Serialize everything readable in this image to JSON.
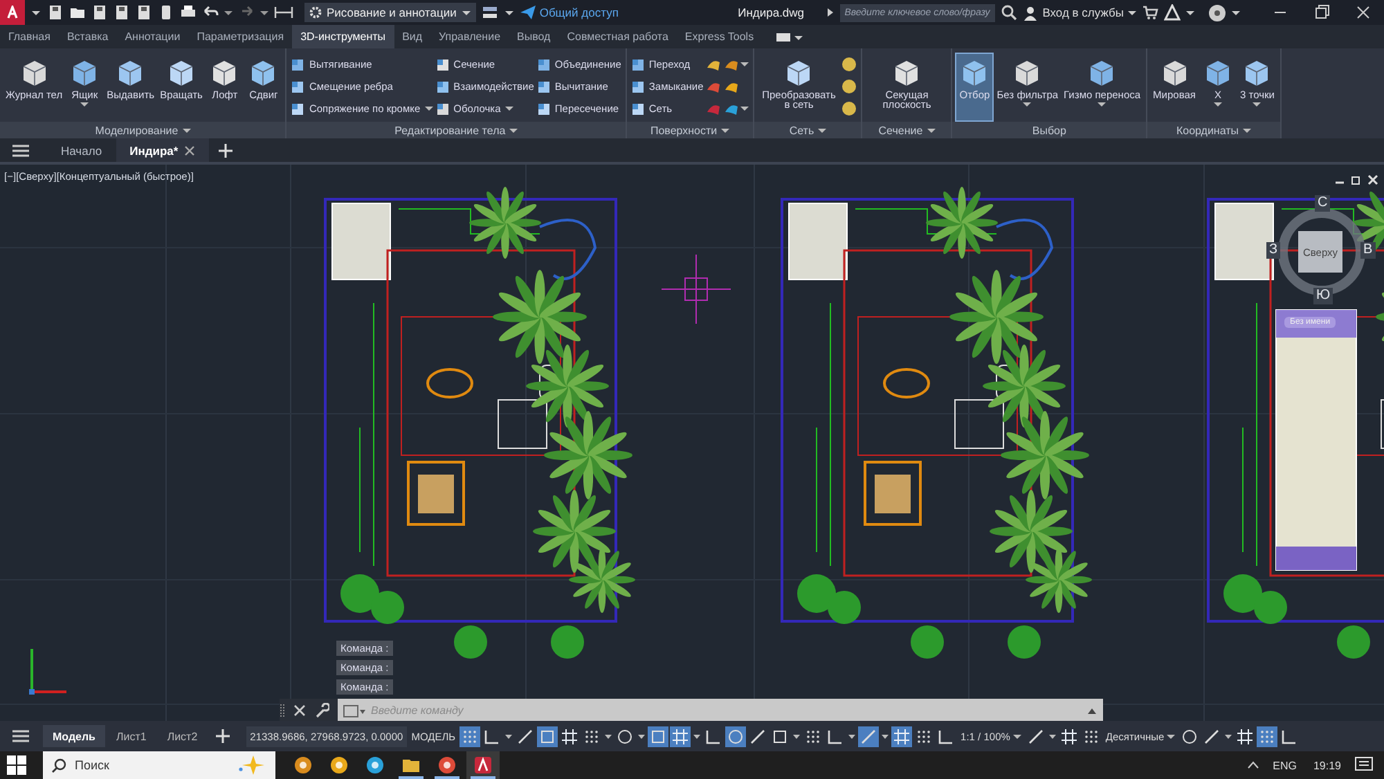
{
  "title_bar": {
    "workspace": "Рисование и аннотации",
    "share": "Общий доступ",
    "title": "Индира.dwg",
    "search": {
      "placeholder": "Введите ключевое слово/фразу"
    },
    "sign_in": "Вход в службы"
  },
  "ribbon": {
    "tabs": [
      {
        "label": "Главная",
        "selected": false
      },
      {
        "label": "Вставка",
        "selected": false
      },
      {
        "label": "Аннотации",
        "selected": false
      },
      {
        "label": "Параметризация",
        "selected": false
      },
      {
        "label": "3D-инструменты",
        "selected": true
      },
      {
        "label": "Вид",
        "selected": false
      },
      {
        "label": "Управление",
        "selected": false
      },
      {
        "label": "Вывод",
        "selected": false
      },
      {
        "label": "Совместная работа",
        "selected": false
      },
      {
        "label": "Express Tools",
        "selected": false
      }
    ],
    "panels": [
      {
        "title": "Моделирование",
        "menu": true,
        "items": [
          {
            "kind": "large",
            "label": "Журнал тел"
          },
          {
            "kind": "large",
            "label": "Ящик",
            "dropdown": true
          },
          {
            "kind": "large",
            "label": "Выдавить"
          },
          {
            "kind": "large",
            "label": "Вращать"
          },
          {
            "kind": "large",
            "label": "Лофт"
          },
          {
            "kind": "large",
            "label": "Сдвиг"
          }
        ]
      },
      {
        "title": "Редактирование тела",
        "menu": true,
        "items": [
          {
            "kind": "small",
            "label": "Вытягивание"
          },
          {
            "kind": "small",
            "label": "Смещение ребра"
          },
          {
            "kind": "small",
            "label": "Сопряжение по кромке",
            "dropdown": true
          },
          {
            "kind": "small",
            "label": "Сечение"
          },
          {
            "kind": "small",
            "label": "Взаимодействие"
          },
          {
            "kind": "small",
            "label": "Оболочка",
            "dropdown": true
          },
          {
            "kind": "small",
            "label": "Объединение"
          },
          {
            "kind": "small",
            "label": "Вычитание"
          },
          {
            "kind": "small",
            "label": "Пересечение"
          }
        ]
      },
      {
        "title": "Поверхности",
        "menu": true,
        "items": [
          {
            "kind": "small",
            "label": "Переход"
          },
          {
            "kind": "small",
            "label": "Замыкание"
          },
          {
            "kind": "small",
            "label": "Сеть"
          },
          {
            "kind": "icon"
          },
          {
            "kind": "icon"
          },
          {
            "kind": "icon"
          },
          {
            "kind": "icon",
            "dropdown": true
          },
          {
            "kind": "icon"
          },
          {
            "kind": "icon",
            "dropdown": true
          }
        ]
      },
      {
        "title": "Сеть",
        "menu": true,
        "items": [
          {
            "kind": "large",
            "label": "Преобразовать в сеть"
          },
          {
            "kind": "icon"
          },
          {
            "kind": "icon"
          },
          {
            "kind": "icon"
          }
        ]
      },
      {
        "title": "Сечение",
        "menu": true,
        "items": [
          {
            "kind": "large",
            "label": "Секущая плоскость"
          }
        ]
      },
      {
        "title": "Выбор",
        "menu": false,
        "items": [
          {
            "kind": "large",
            "label": "Отбор",
            "selected": true
          },
          {
            "kind": "large",
            "label": "Без фильтра",
            "dropdown": true,
            "selected": false
          },
          {
            "kind": "large",
            "label": "Гизмо переноса",
            "dropdown": true,
            "selected": false
          }
        ]
      },
      {
        "title": "Координаты",
        "menu": true,
        "items": [
          {
            "kind": "large",
            "label": "Мировая"
          },
          {
            "kind": "large",
            "label": "X",
            "dropdown": true
          },
          {
            "kind": "large",
            "label": "3 точки",
            "dropdown": true
          }
        ]
      }
    ]
  },
  "file_tabs": [
    {
      "label": "Начало",
      "selected": false,
      "closable": false
    },
    {
      "label": "Индира*",
      "selected": true,
      "closable": true
    }
  ],
  "viewport": {
    "controls": [
      "[−]",
      "[Сверху]",
      "[Концептуальный (быстрое)]"
    ],
    "viewcube": {
      "top": "Сверху",
      "north": "С",
      "west": "З",
      "east": "В",
      "south": "Ю",
      "ucs": "Без имени"
    },
    "history": [
      "Команда :",
      "Команда :",
      "Команда :"
    ],
    "command": {
      "placeholder": "Введите команду"
    }
  },
  "status_bar": {
    "layouts": [
      {
        "label": "Модель",
        "selected": true
      },
      {
        "label": "Лист1",
        "selected": false
      },
      {
        "label": "Лист2",
        "selected": false
      }
    ],
    "coordinates": "21338.9686, 27968.9723, 0.0000",
    "tools": [
      {
        "kind": "button",
        "label": "МОДЕЛЬ"
      },
      {
        "kind": "toggle",
        "on": true
      },
      {
        "kind": "toggle",
        "on": false
      },
      {
        "kind": "caret"
      },
      {
        "kind": "toggle",
        "on": false
      },
      {
        "kind": "toggle",
        "on": true
      },
      {
        "kind": "toggle",
        "on": false
      },
      {
        "kind": "toggle",
        "on": false
      },
      {
        "kind": "caret"
      },
      {
        "kind": "toggle",
        "on": false
      },
      {
        "kind": "caret"
      },
      {
        "kind": "toggle",
        "on": true
      },
      {
        "kind": "toggle",
        "on": true
      },
      {
        "kind": "caret"
      },
      {
        "kind": "toggle",
        "on": false
      },
      {
        "kind": "toggle",
        "on": true
      },
      {
        "kind": "toggle",
        "on": false
      },
      {
        "kind": "toggle",
        "on": false
      },
      {
        "kind": "caret"
      },
      {
        "kind": "toggle",
        "on": false
      },
      {
        "kind": "toggle",
        "on": false
      },
      {
        "kind": "caret"
      },
      {
        "kind": "toggle",
        "on": true
      },
      {
        "kind": "caret"
      },
      {
        "kind": "toggle",
        "on": true
      },
      {
        "kind": "toggle",
        "on": false
      },
      {
        "kind": "toggle",
        "on": false
      },
      {
        "kind": "button",
        "label": "1:1 / 100%",
        "menu": true
      },
      {
        "kind": "toggle",
        "on": false
      },
      {
        "kind": "caret"
      },
      {
        "kind": "toggle",
        "on": false
      },
      {
        "kind": "toggle",
        "on": false
      },
      {
        "kind": "button",
        "label": "Десятичные",
        "menu": true
      },
      {
        "kind": "toggle",
        "on": false
      },
      {
        "kind": "toggle",
        "on": false
      },
      {
        "kind": "caret"
      },
      {
        "kind": "toggle",
        "on": false
      },
      {
        "kind": "toggle",
        "on": true
      },
      {
        "kind": "toggle",
        "on": false
      }
    ]
  },
  "taskbar": {
    "search": {
      "placeholder": "Поиск"
    },
    "apps": [
      {
        "open": false,
        "selected": false
      },
      {
        "open": false,
        "selected": false
      },
      {
        "open": false,
        "selected": false
      },
      {
        "open": true,
        "selected": false
      },
      {
        "open": true,
        "selected": false
      },
      {
        "open": true,
        "selected": true
      }
    ],
    "language": "ENG",
    "time": "19:19"
  }
}
